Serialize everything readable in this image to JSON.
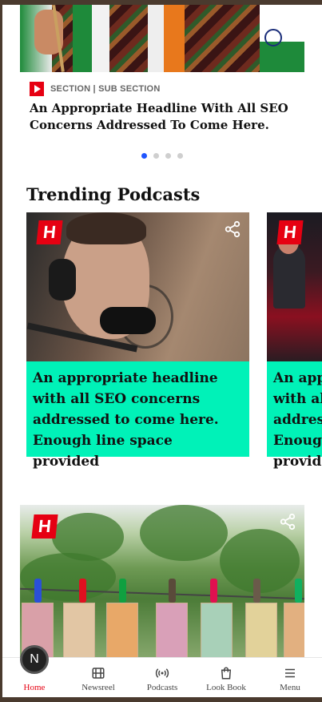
{
  "hero": {
    "section_label": "SECTION | SUB SECTION",
    "headline": "An Appropriate Headline With All SEO Concerns Addressed To Come Here.",
    "carousel_dots": 4,
    "active_dot": 0
  },
  "trending": {
    "title": "Trending Podcasts",
    "cards": [
      {
        "headline": "An appropriate headline with all SEO concerns addressed to come here. Enough line space provided"
      },
      {
        "headline": "An appropriate headline with all SEO concerns addressed to come here. Enough line space provided"
      }
    ]
  },
  "brand": {
    "logo_letter": "H",
    "home_avatar_letter": "N"
  },
  "colors": {
    "accent_red": "#e60012",
    "teal": "#00f2b8",
    "dot_active": "#1f55ff"
  },
  "bottom_nav": {
    "items": [
      {
        "label": "Home",
        "icon": "home-icon",
        "active": true
      },
      {
        "label": "Newsreel",
        "icon": "film-icon",
        "active": false
      },
      {
        "label": "Podcasts",
        "icon": "broadcast-icon",
        "active": false
      },
      {
        "label": "Look Book",
        "icon": "bag-icon",
        "active": false
      },
      {
        "label": "Menu",
        "icon": "hamburger-icon",
        "active": false
      }
    ]
  }
}
